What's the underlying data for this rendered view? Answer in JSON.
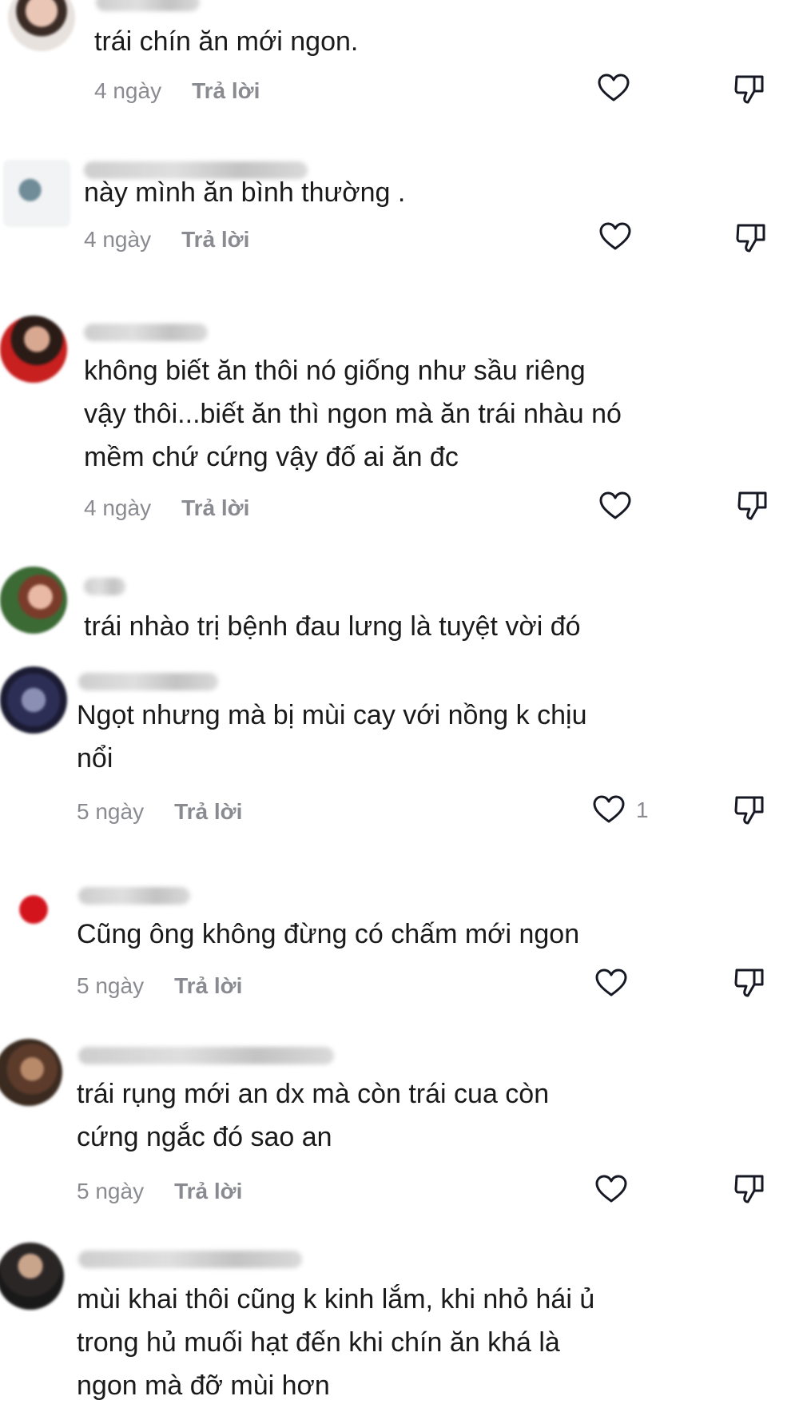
{
  "comments": [
    {
      "text": [
        "trái chín ăn mới ngon."
      ],
      "time": "4 ngày",
      "reply": "Trả lời",
      "likes": ""
    },
    {
      "text": [
        "này mình ăn bình thường ."
      ],
      "time": "4 ngày",
      "reply": "Trả lời",
      "likes": ""
    },
    {
      "text": [
        "không biết ăn thôi nó giống như sầu riêng",
        "vậy thôi...biết ăn thì ngon mà ăn trái nhàu nó",
        "mềm chứ cứng vậy đố ai ăn đc"
      ],
      "time": "4 ngày",
      "reply": "Trả lời",
      "likes": ""
    },
    {
      "text": [
        "trái nhào trị bệnh đau lưng là tuyệt vời đó"
      ],
      "time": "",
      "reply": "",
      "likes": ""
    },
    {
      "text": [
        "Ngọt nhưng mà bị mùi cay với nồng k chịu",
        "nổi"
      ],
      "time": "5 ngày",
      "reply": "Trả lời",
      "likes": "1"
    },
    {
      "text": [
        "Cũng ông không đừng có chấm mới ngon"
      ],
      "time": "5 ngày",
      "reply": "Trả lời",
      "likes": ""
    },
    {
      "text": [
        "trái rụng mới an dx mà còn trái cua còn",
        "cứng ngắc đó sao an"
      ],
      "time": "5 ngày",
      "reply": "Trả lời",
      "likes": ""
    },
    {
      "text": [
        "mùi khai thôi cũng k kinh lắm, khi nhỏ hái ủ",
        "trong hủ muối hạt đến khi chín ăn khá là",
        "ngon mà đỡ mùi hơn"
      ],
      "time": "",
      "reply": "",
      "likes": ""
    }
  ],
  "icons": {
    "like": "heart-outline-icon",
    "dislike": "thumbs-down-icon"
  },
  "colors": {
    "text": "#1a1a1a",
    "meta": "#8a8b91",
    "icon": "#161823"
  }
}
